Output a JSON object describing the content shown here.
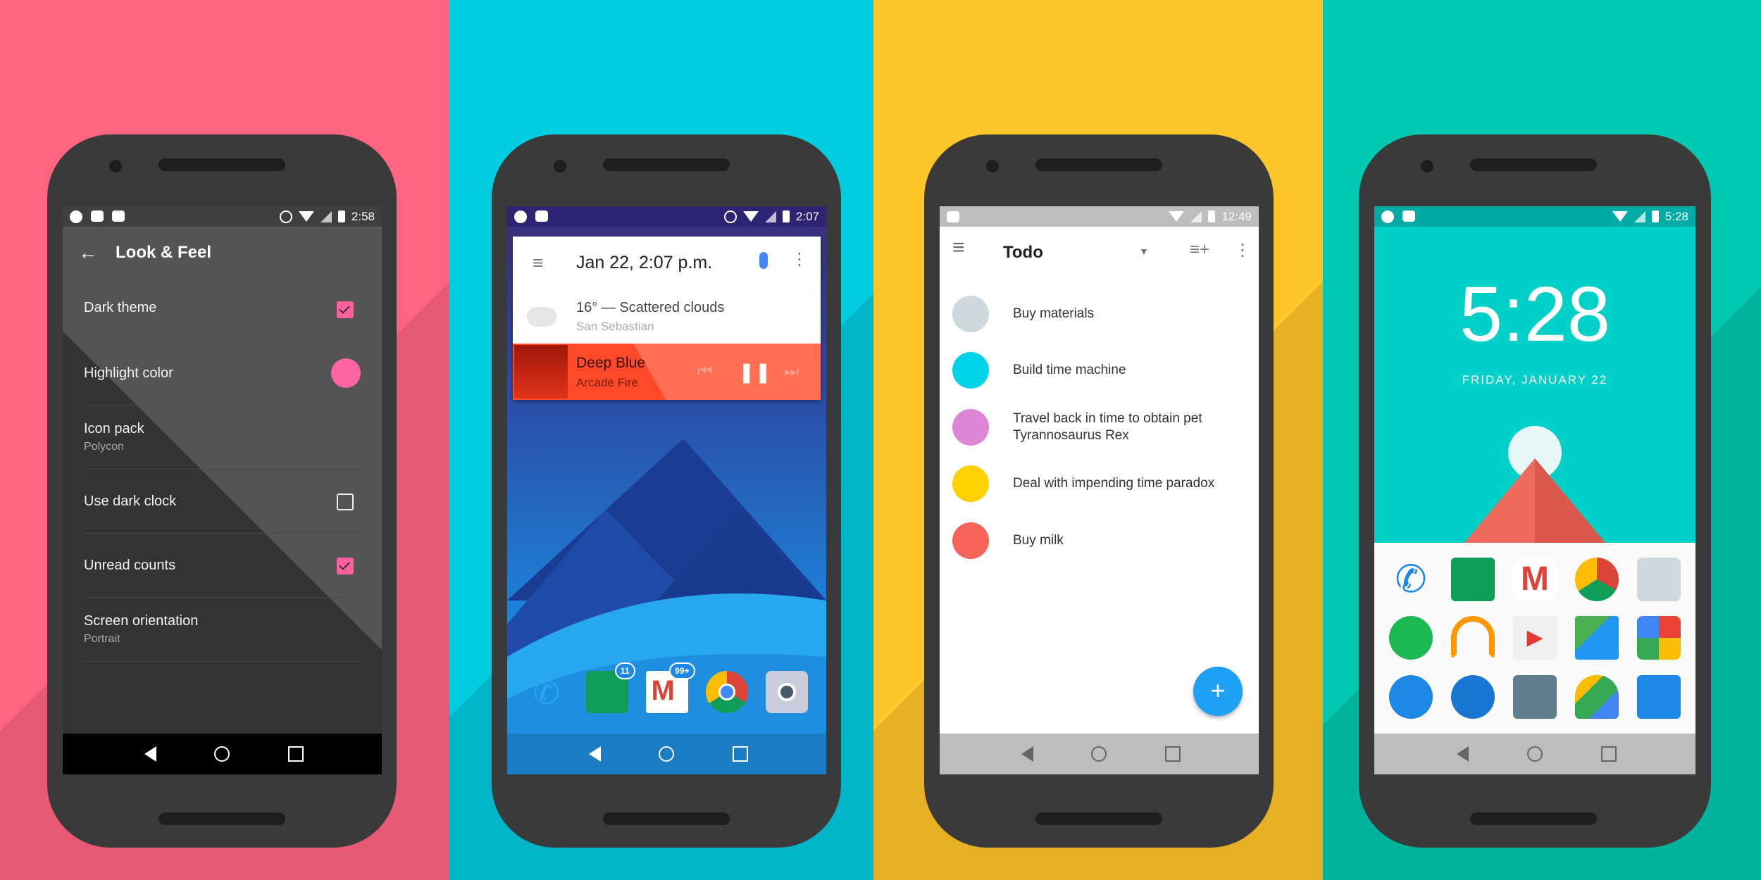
{
  "backgrounds": {
    "pink": "#fd6581",
    "cyan": "#00cde0",
    "yellow": "#ffc629",
    "teal": "#00c9b1"
  },
  "phone1": {
    "status_time": "2:58",
    "toolbar": {
      "back_icon": "arrow-left-icon",
      "title": "Look & Feel"
    },
    "settings": [
      {
        "title": "Dark theme",
        "control": "checkbox",
        "checked": true
      },
      {
        "title": "Highlight color",
        "control": "color-swatch",
        "color": "#ff64a5"
      },
      {
        "title": "Icon pack",
        "subtitle": "Polycon"
      },
      {
        "title": "Use dark clock",
        "control": "checkbox",
        "checked": false
      },
      {
        "title": "Unread counts",
        "control": "checkbox",
        "checked": true
      },
      {
        "title": "Screen orientation",
        "subtitle": "Portrait"
      }
    ]
  },
  "phone2": {
    "status_time": "2:07",
    "search_card": {
      "datetime": "Jan 22, 2:07 p.m.",
      "mic_icon": "mic-icon",
      "menu_icon": "more-vert-icon"
    },
    "weather": {
      "summary": "16° — Scattered clouds",
      "location": "San Sebastian",
      "icon": "cloud-icon"
    },
    "music": {
      "title": "Deep Blue",
      "artist": "Arcade Fire",
      "color": "#ff5a3c"
    },
    "dock": [
      {
        "name": "phone",
        "badge": ""
      },
      {
        "name": "messenger",
        "badge": "11"
      },
      {
        "name": "gmail",
        "badge": "99+"
      },
      {
        "name": "chrome",
        "badge": ""
      },
      {
        "name": "camera",
        "badge": ""
      }
    ]
  },
  "phone3": {
    "status_time": "12:49",
    "toolbar": {
      "title": "Todo"
    },
    "items": [
      {
        "text": "Buy materials",
        "color": "#cfd8dc"
      },
      {
        "text": "Build time machine",
        "color": "#00d2e8"
      },
      {
        "text": "Travel back in time to obtain pet Tyrannosaurus Rex",
        "color": "#dd86d8"
      },
      {
        "text": "Deal with impending time paradox",
        "color": "#ffd100"
      },
      {
        "text": "Buy milk",
        "color": "#f76259"
      }
    ],
    "fab": {
      "label": "+",
      "color": "#1ea1f5"
    }
  },
  "phone4": {
    "status_time": "5:28",
    "clock": "5:28",
    "date": "FRIDAY, JANUARY 22",
    "apps": [
      "phone",
      "messenger",
      "gmail",
      "chrome",
      "camera",
      "spotify",
      "play-music",
      "play-store",
      "maps",
      "photos",
      "messages",
      "keyguard",
      "calculator",
      "drive",
      "car"
    ]
  }
}
